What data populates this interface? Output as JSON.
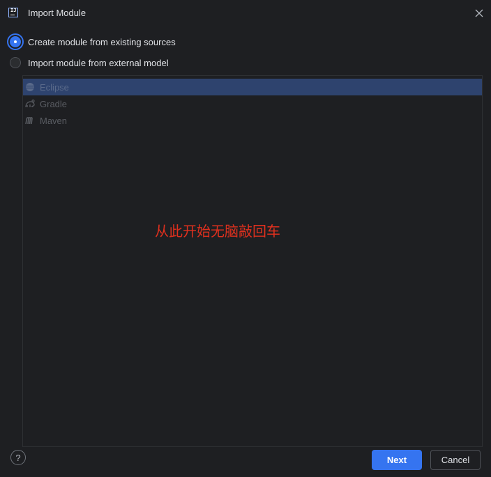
{
  "window": {
    "title": "Import Module",
    "app_icon_text": "IJ",
    "close_icon": "close-icon"
  },
  "options": [
    {
      "label": "Create module from existing sources",
      "checked": true
    },
    {
      "label": "Import module from external model",
      "checked": false
    }
  ],
  "models": [
    {
      "label": "Eclipse",
      "icon": "eclipse-icon",
      "selected": true
    },
    {
      "label": "Gradle",
      "icon": "gradle-icon",
      "selected": false
    },
    {
      "label": "Maven",
      "icon": "maven-icon",
      "selected": false
    }
  ],
  "annotation": "从此开始无脑敲回车",
  "footer": {
    "help_label": "?",
    "next_label": "Next",
    "cancel_label": "Cancel"
  },
  "colors": {
    "accent": "#3574f0",
    "background": "#1e1f22",
    "selection": "#2e436e",
    "annotation": "#e0301e"
  }
}
